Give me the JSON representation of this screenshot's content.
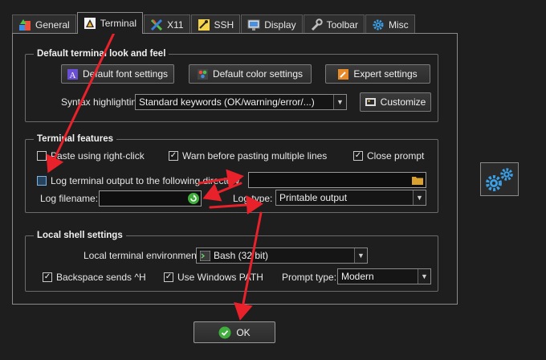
{
  "tabs": [
    {
      "label": "General",
      "icon": "general-icon"
    },
    {
      "label": "Terminal",
      "icon": "terminal-icon",
      "active": true
    },
    {
      "label": "X11",
      "icon": "x11-icon"
    },
    {
      "label": "SSH",
      "icon": "ssh-icon"
    },
    {
      "label": "Display",
      "icon": "display-icon"
    },
    {
      "label": "Toolbar",
      "icon": "wrench-icon"
    },
    {
      "label": "Misc",
      "icon": "gear-icon"
    }
  ],
  "look_and_feel": {
    "legend": "Default terminal look and feel",
    "font_button": "Default font settings",
    "color_button": "Default color settings",
    "expert_button": "Expert settings",
    "syntax_label": "Syntax highlighting:",
    "syntax_value": "Standard keywords (OK/warning/error/...)",
    "customize_button": "Customize"
  },
  "features": {
    "legend": "Terminal features",
    "paste_right_click": {
      "label": "Paste using right-click",
      "checked": false
    },
    "warn_paste": {
      "label": "Warn before pasting multiple lines",
      "checked": true
    },
    "close_prompt": {
      "label": "Close prompt",
      "checked": true
    },
    "log_output": {
      "label": "Log terminal output to the following directory",
      "checked": false
    },
    "log_dir_value": "",
    "log_filename_label": "Log filename:",
    "log_filename_value": "",
    "log_type_label": "Log type:",
    "log_type_value": "Printable output"
  },
  "local_shell": {
    "legend": "Local shell settings",
    "env_label": "Local terminal environment:",
    "env_value": "Bash (32 bit)",
    "backspace": {
      "label": "Backspace sends ^H",
      "checked": true
    },
    "windows_path": {
      "label": "Use Windows PATH",
      "checked": true
    },
    "prompt_type_label": "Prompt type:",
    "prompt_type_value": "Modern"
  },
  "ok_button": "OK",
  "colors": {
    "background": "#1e1e1e",
    "annotation_arrow": "#e8212b",
    "accent_blue": "#2a86d1"
  }
}
